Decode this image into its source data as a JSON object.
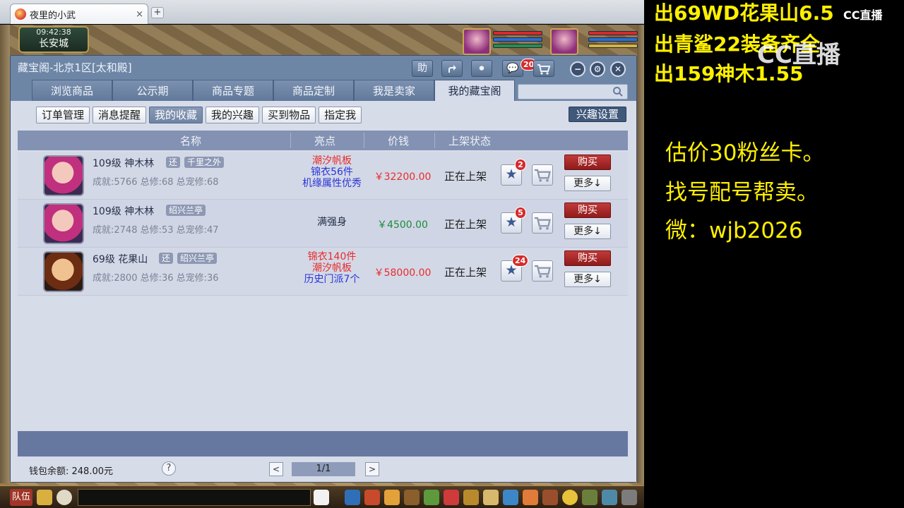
{
  "browser": {
    "tab_title": "夜里的小武",
    "tab_close": "×",
    "new_tab": "+"
  },
  "hud": {
    "time": "09:42:38",
    "city": "长安城",
    "hp_color": "#d82a2a",
    "mp_color": "#2b6fd1"
  },
  "panel": {
    "title": "藏宝阁-北京1区[太和殿]",
    "header_buttons": {
      "help": "助",
      "message_count": "20"
    },
    "tabs": [
      "浏览商品",
      "公示期",
      "商品专题",
      "商品定制",
      "我是卖家",
      "我的藏宝阁"
    ],
    "active_tab": 5,
    "search": {
      "placeholder": ""
    },
    "subtabs": [
      "订单管理",
      "消息提醒",
      "我的收藏",
      "我的兴趣",
      "买到物品",
      "指定我"
    ],
    "active_subtab": 2,
    "interest_settings": "兴趣设置",
    "columns": {
      "name": "名称",
      "highlights": "亮点",
      "price": "价钱",
      "status": "上架状态"
    },
    "rows": [
      {
        "avatar": "shenmulin",
        "level_line": "109级 神木林",
        "tags": [
          "还",
          "千里之外"
        ],
        "stats": "成就:5766 总修:68 总宠修:68",
        "highlights": [
          {
            "text": "潮汐帆板",
            "color": "red"
          },
          {
            "text": "锦衣56件",
            "color": "blue"
          },
          {
            "text": "机缘属性优秀",
            "color": "blue"
          }
        ],
        "price": "￥32200.00",
        "price_color": "red",
        "status": "正在上架",
        "favorites": "2",
        "buy": "购买",
        "more": "更多↓"
      },
      {
        "avatar": "shenmulin",
        "level_line": "109级 神木林",
        "tags": [
          "绍兴兰亭"
        ],
        "stats": "成就:2748 总修:53 总宠修:47",
        "highlights": [
          {
            "text": "满强身",
            "color": "dark"
          }
        ],
        "price": "￥4500.00",
        "price_color": "green",
        "status": "正在上架",
        "favorites": "5",
        "buy": "购买",
        "more": "更多↓"
      },
      {
        "avatar": "huaguoshan",
        "level_line": "69级 花果山",
        "tags": [
          "还",
          "绍兴兰亭"
        ],
        "stats": "成就:2800 总修:36 总宠修:36",
        "highlights": [
          {
            "text": "锦衣140件",
            "color": "red"
          },
          {
            "text": "潮汐帆板",
            "color": "red"
          },
          {
            "text": "历史门派7个",
            "color": "blue"
          }
        ],
        "price": "￥58000.00",
        "price_color": "red",
        "status": "正在上架",
        "favorites": "24",
        "buy": "购买",
        "more": "更多↓"
      }
    ],
    "wallet": "钱包余额: 248.00元",
    "help": "?",
    "pagination": {
      "prev": "<",
      "current": "1/1",
      "next": ">"
    }
  },
  "bottom_bar": {
    "team": "队伍"
  },
  "overlay": {
    "promo_lines": [
      "出69WD花果山6.5",
      "出青鲨22装备齐全",
      "出159神木1.55"
    ],
    "logo_small": "CC直播",
    "logo_big": "CC直播",
    "info_lines": [
      "估价30粉丝卡。",
      "找号配号帮卖。",
      "微：wjb2026"
    ],
    "promo_color": "#fff000"
  }
}
